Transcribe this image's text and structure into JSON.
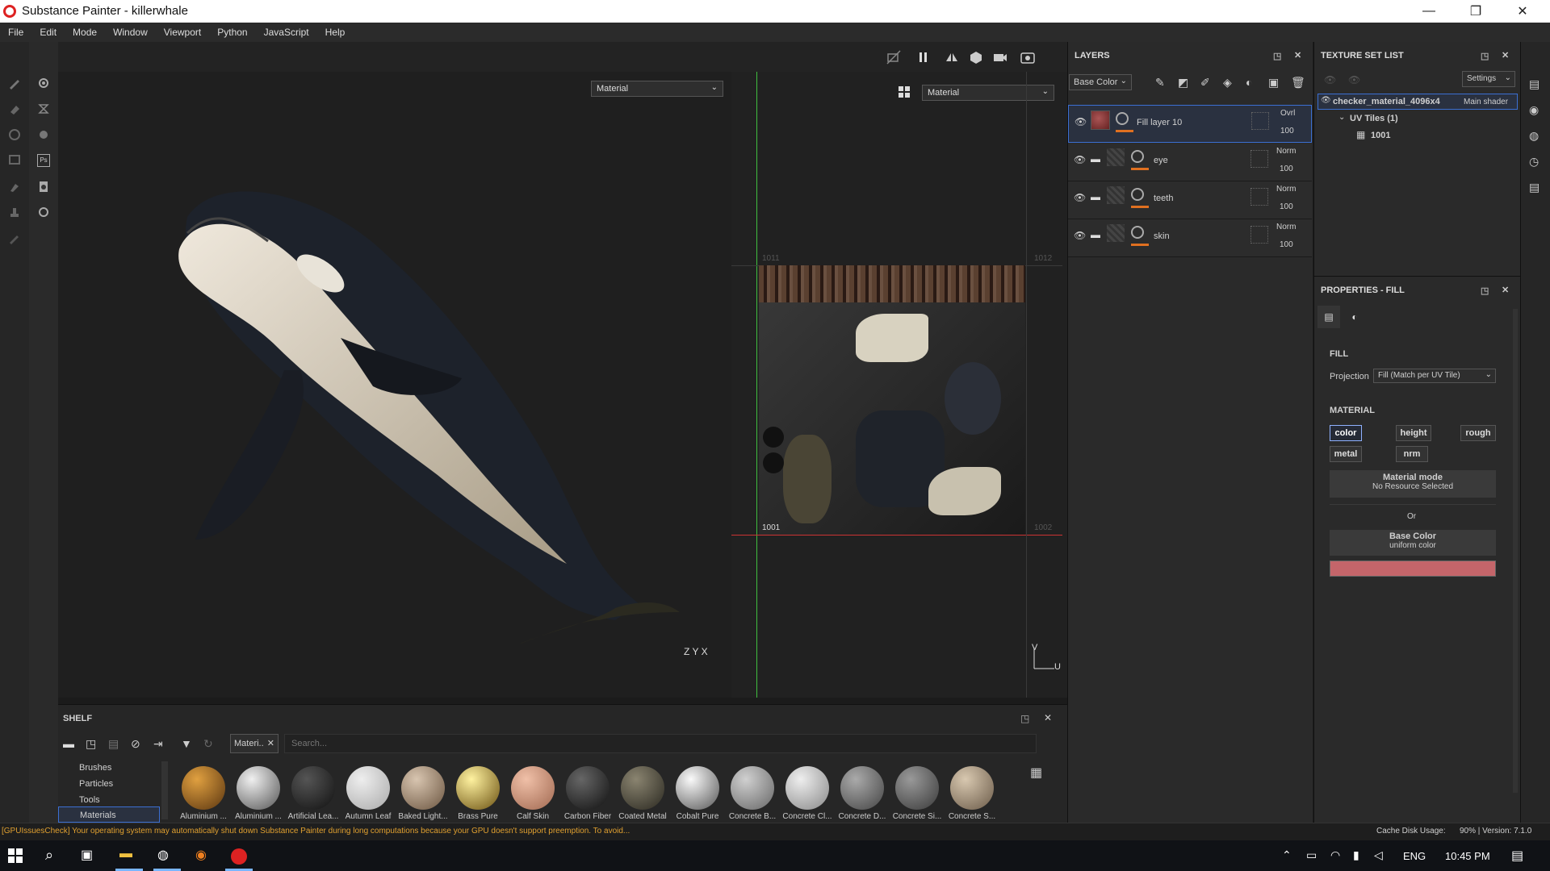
{
  "window": {
    "title": "Substance Painter - killerwhale",
    "minimize": "—",
    "maximize": "❐",
    "close": "✕"
  },
  "menu": [
    "File",
    "Edit",
    "Mode",
    "Window",
    "Viewport",
    "Python",
    "JavaScript",
    "Help"
  ],
  "viewport": {
    "left_dropdown": "Material",
    "right_dropdown": "Material",
    "axis_3d": "Z Y X",
    "uv_tiles": [
      "1011",
      "1012",
      "1001",
      "1002"
    ],
    "uv_axis_v": "V",
    "uv_axis_u": "U"
  },
  "layers": {
    "title": "LAYERS",
    "channel": "Base Color",
    "rows": [
      {
        "name": "Fill layer 10",
        "blend": "Ovrl",
        "opacity": "100",
        "selected": true
      },
      {
        "name": "eye",
        "blend": "Norm",
        "opacity": "100",
        "selected": false
      },
      {
        "name": "teeth",
        "blend": "Norm",
        "opacity": "100",
        "selected": false
      },
      {
        "name": "skin",
        "blend": "Norm",
        "opacity": "100",
        "selected": false
      }
    ]
  },
  "texture_set": {
    "title": "TEXTURE SET LIST",
    "settings": "Settings",
    "material_name": "checker_material_4096x4",
    "shader": "Main shader",
    "uv_tiles": "UV Tiles (1)",
    "tile": "1001"
  },
  "properties": {
    "title": "PROPERTIES - FILL",
    "fill_label": "FILL",
    "projection_label": "Projection",
    "projection_value": "Fill (Match per UV Tile)",
    "material_label": "MATERIAL",
    "channels": [
      "color",
      "height",
      "rough",
      "metal",
      "nrm"
    ],
    "material_mode": "Material mode",
    "no_resource": "No Resource Selected",
    "or": "Or",
    "base_color": "Base Color",
    "uniform_color": "uniform color",
    "swatch_color": "#c4656a"
  },
  "shelf": {
    "title": "SHELF",
    "filter_tag": "Materi..",
    "search_placeholder": "Search...",
    "categories": [
      "Brushes",
      "Particles",
      "Tools",
      "Materials"
    ],
    "materials": [
      {
        "name": "Aluminium ...",
        "c1": "#e0a040",
        "c2": "#5a3510"
      },
      {
        "name": "Aluminium ...",
        "c1": "#f0f0f0",
        "c2": "#555"
      },
      {
        "name": "Artificial Lea...",
        "c1": "#555",
        "c2": "#111"
      },
      {
        "name": "Autumn Leaf",
        "c1": "#eee",
        "c2": "#aaa"
      },
      {
        "name": "Baked Light...",
        "c1": "#d8c5b0",
        "c2": "#6b5540"
      },
      {
        "name": "Brass Pure",
        "c1": "#fff2a0",
        "c2": "#6a5010"
      },
      {
        "name": "Calf Skin",
        "c1": "#f0c0a8",
        "c2": "#a06850"
      },
      {
        "name": "Carbon Fiber",
        "c1": "#666",
        "c2": "#111"
      },
      {
        "name": "Coated Metal",
        "c1": "#8a8470",
        "c2": "#2a2820"
      },
      {
        "name": "Cobalt Pure",
        "c1": "#fafafa",
        "c2": "#555"
      },
      {
        "name": "Concrete B...",
        "c1": "#d0d0d0",
        "c2": "#666"
      },
      {
        "name": "Concrete Cl...",
        "c1": "#eee",
        "c2": "#888"
      },
      {
        "name": "Concrete D...",
        "c1": "#aaa",
        "c2": "#444"
      },
      {
        "name": "Concrete Si...",
        "c1": "#999",
        "c2": "#3a3a3a"
      },
      {
        "name": "Concrete S...",
        "c1": "#d8c8b0",
        "c2": "#6a5a48"
      }
    ]
  },
  "status": {
    "message": "[GPUIssuesCheck] Your operating system may automatically shut down Substance Painter during long computations because your GPU doesn't support preemption. To avoid...",
    "cache": "Cache Disk Usage:",
    "cache_value": "90% | Version: 7.1.0"
  },
  "taskbar": {
    "language": "ENG",
    "time": "10:45 PM"
  }
}
